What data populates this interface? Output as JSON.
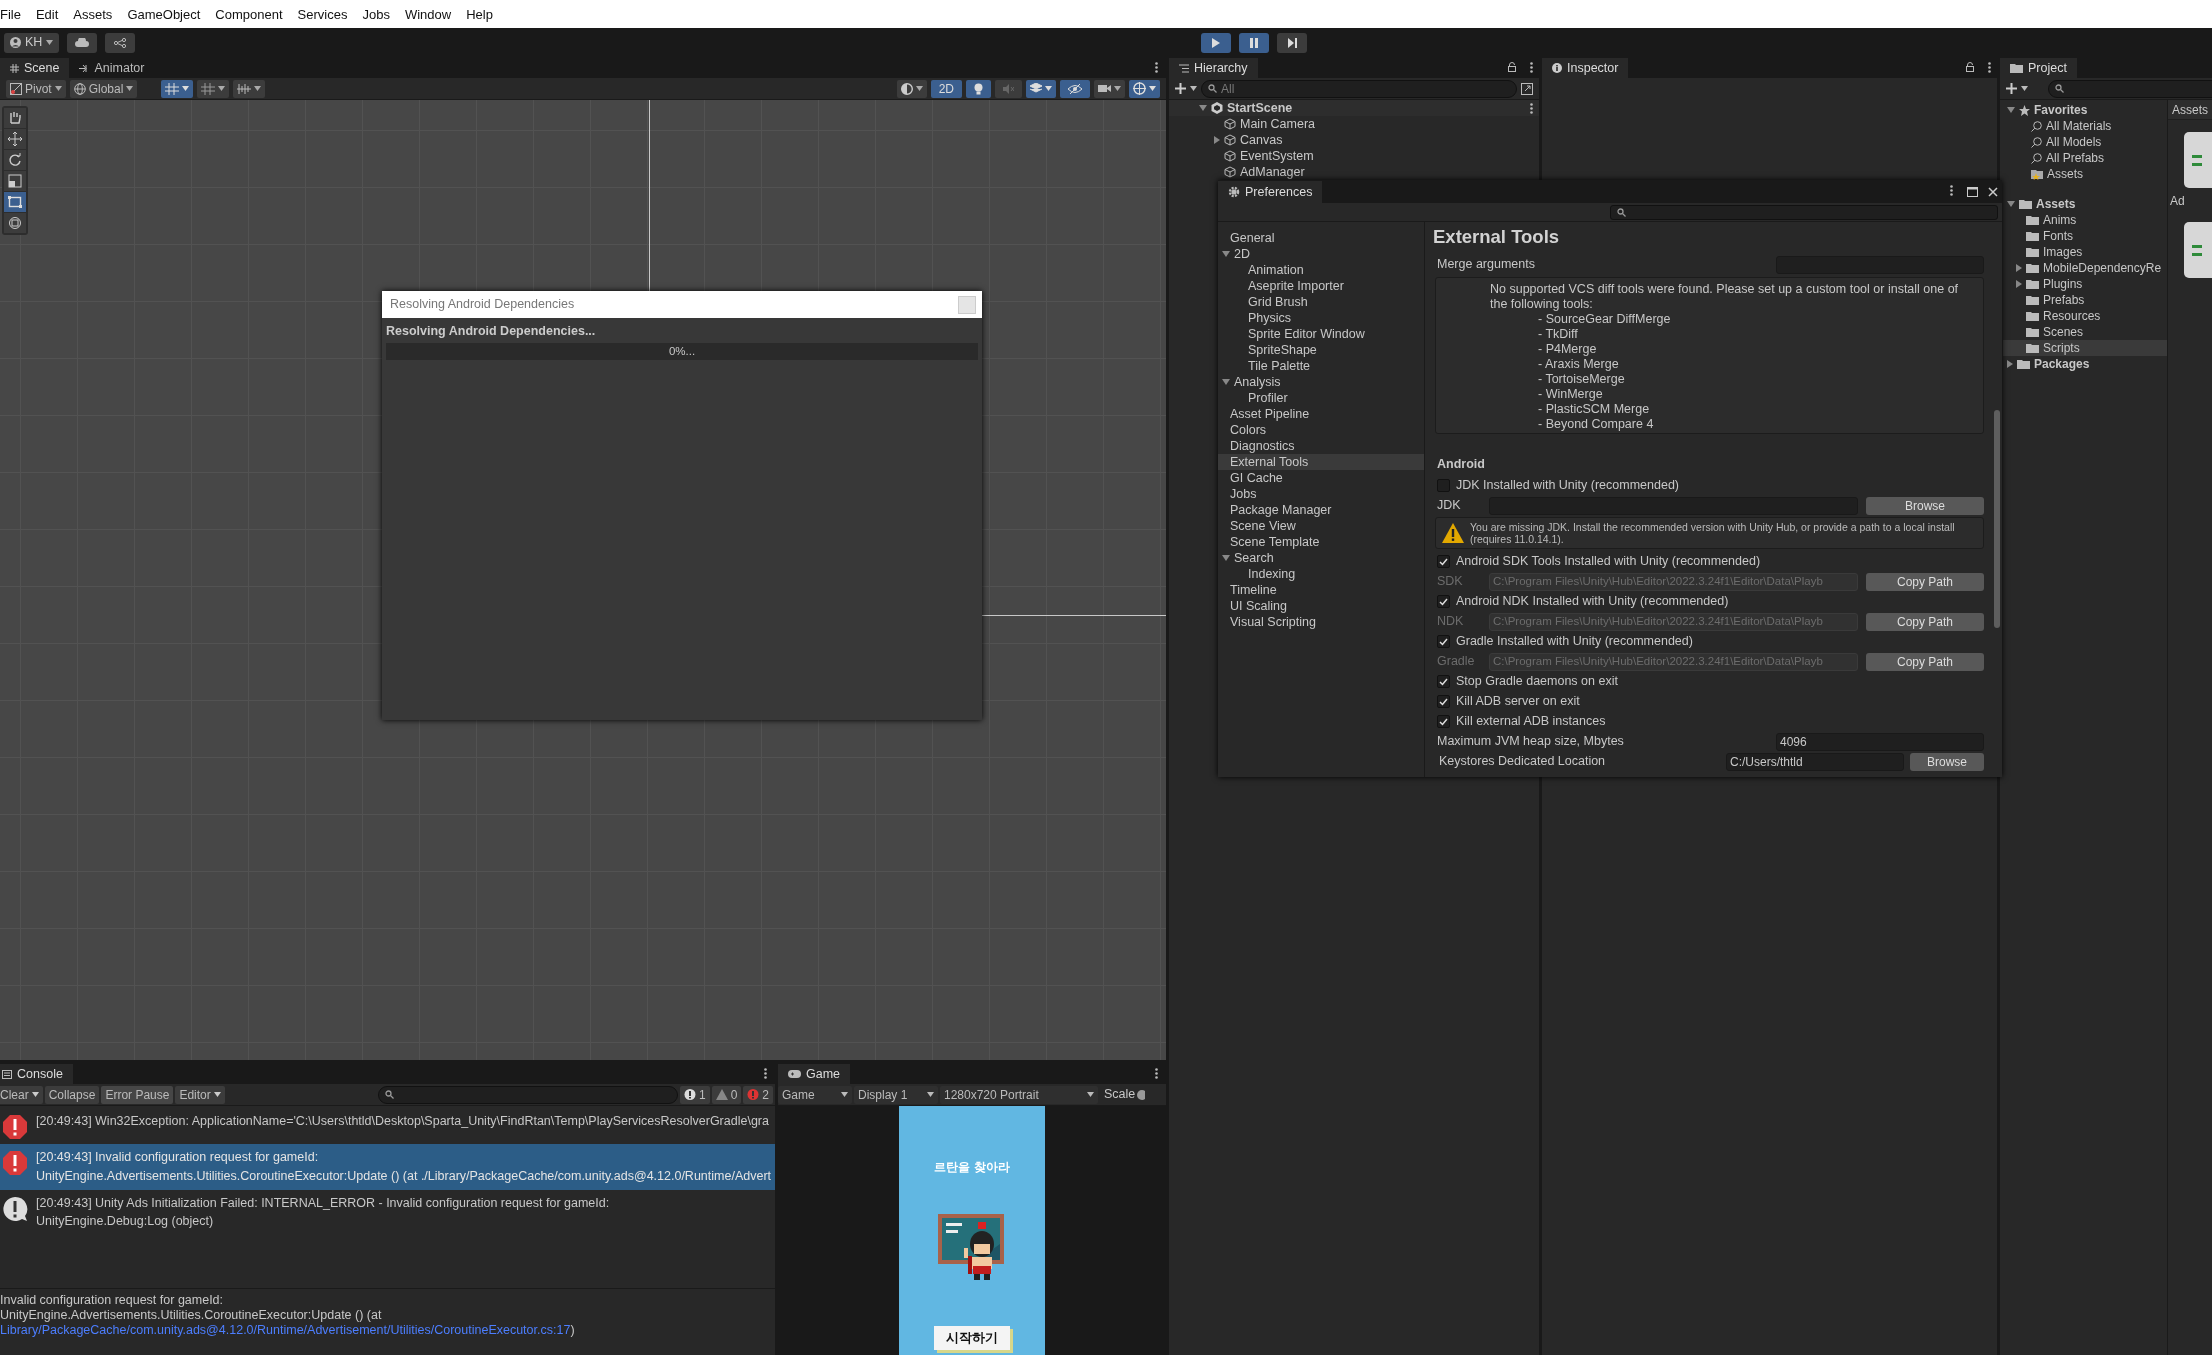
{
  "menu_bar": [
    "File",
    "Edit",
    "Assets",
    "GameObject",
    "Component",
    "Services",
    "Jobs",
    "Window",
    "Help"
  ],
  "toolbar": {
    "account": "KH",
    "playing": true,
    "paused": true
  },
  "scene_panel": {
    "tabs": [
      {
        "label": "Scene",
        "selected": true
      },
      {
        "label": "Animator",
        "selected": false
      }
    ],
    "pivot": "Pivot",
    "space": "Global",
    "mode_2d": {
      "label": "2D",
      "on": true
    },
    "toggles": [
      {
        "kind": "grid_snap",
        "on": true
      },
      {
        "kind": "lighting",
        "on": true
      },
      {
        "kind": "audio",
        "on": false
      },
      {
        "kind": "effects",
        "on": true
      },
      {
        "kind": "visibility",
        "on": true
      },
      {
        "kind": "gizmos",
        "on": true
      }
    ],
    "tools": [
      {
        "kind": "hand",
        "selected": false
      },
      {
        "kind": "move",
        "selected": false
      },
      {
        "kind": "rotate",
        "selected": false
      },
      {
        "kind": "scale",
        "selected": false
      },
      {
        "kind": "rect",
        "selected": true
      },
      {
        "kind": "transform",
        "selected": false
      }
    ]
  },
  "dialog": {
    "title": "Resolving Android Dependencies",
    "message": "Resolving Android Dependencies...",
    "progress_label": "0%...",
    "level": 0
  },
  "hierarchy": {
    "title": "Hierarchy",
    "placeholder": "All",
    "scene": "StartScene",
    "items": [
      {
        "label": "Main Camera",
        "expandable": false
      },
      {
        "label": "Canvas",
        "expandable": true
      },
      {
        "label": "EventSystem",
        "expandable": false
      },
      {
        "label": "AdManager",
        "expandable": false
      }
    ]
  },
  "inspector": {
    "title": "Inspector"
  },
  "preferences": {
    "title": "Preferences",
    "nav": [
      {
        "label": "General",
        "selected": false
      },
      {
        "label": "2D",
        "selected": false,
        "expanded": true,
        "children": [
          {
            "label": "Animation",
            "selected": false
          },
          {
            "label": "Aseprite Importer",
            "selected": false
          },
          {
            "label": "Grid Brush",
            "selected": false
          },
          {
            "label": "Physics",
            "selected": false
          },
          {
            "label": "Sprite Editor Window",
            "selected": false
          },
          {
            "label": "SpriteShape",
            "selected": false
          },
          {
            "label": "Tile Palette",
            "selected": false
          }
        ]
      },
      {
        "label": "Analysis",
        "selected": false,
        "expanded": true,
        "children": [
          {
            "label": "Profiler",
            "selected": false
          }
        ]
      },
      {
        "label": "Asset Pipeline",
        "selected": false
      },
      {
        "label": "Colors",
        "selected": false
      },
      {
        "label": "Diagnostics",
        "selected": false
      },
      {
        "label": "External Tools",
        "selected": true
      },
      {
        "label": "GI Cache",
        "selected": false
      },
      {
        "label": "Jobs",
        "selected": false
      },
      {
        "label": "Package Manager",
        "selected": false
      },
      {
        "label": "Scene View",
        "selected": false
      },
      {
        "label": "Scene Template",
        "selected": false
      },
      {
        "label": "Search",
        "selected": false,
        "expanded": true,
        "children": [
          {
            "label": "Indexing",
            "selected": false
          }
        ]
      },
      {
        "label": "Timeline",
        "selected": false
      },
      {
        "label": "UI Scaling",
        "selected": false
      },
      {
        "label": "Visual Scripting",
        "selected": false
      }
    ],
    "page_title": "External Tools",
    "merge_label": "Merge arguments",
    "vcs_message": "No supported VCS diff tools were found. Please set up a custom tool or install one of the following tools:",
    "vcs_tools": [
      "- SourceGear DiffMerge",
      "- TkDiff",
      "- P4Merge",
      "- Araxis Merge",
      "- TortoiseMerge",
      "- WinMerge",
      "- PlasticSCM Merge",
      "- Beyond Compare 4"
    ],
    "android_heading": "Android",
    "settings": [
      {
        "kind": "checkbox",
        "label": "JDK Installed with Unity (recommended)",
        "checked": false
      },
      {
        "kind": "path",
        "label": "JDK",
        "button": "Browse",
        "disabled": false
      },
      {
        "kind": "warning",
        "text": "You are missing JDK. Install the recommended version with Unity Hub, or provide a path to a local install (requires 11.0.14.1)."
      },
      {
        "kind": "checkbox",
        "label": "Android SDK Tools Installed with Unity (recommended)",
        "checked": true
      },
      {
        "kind": "path",
        "label": "SDK",
        "value": "C:\\Program Files\\Unity\\Hub\\Editor\\2022.3.24f1\\Editor\\Data\\Playb",
        "button": "Copy Path",
        "disabled": true
      },
      {
        "kind": "checkbox",
        "label": "Android NDK Installed with Unity (recommended)",
        "checked": true
      },
      {
        "kind": "path",
        "label": "NDK",
        "value": "C:\\Program Files\\Unity\\Hub\\Editor\\2022.3.24f1\\Editor\\Data\\Playb",
        "button": "Copy Path",
        "disabled": true
      },
      {
        "kind": "checkbox",
        "label": "Gradle Installed with Unity (recommended)",
        "checked": true
      },
      {
        "kind": "path",
        "label": "Gradle",
        "value": "C:\\Program Files\\Unity\\Hub\\Editor\\2022.3.24f1\\Editor\\Data\\Playb",
        "button": "Copy Path",
        "disabled": true
      },
      {
        "kind": "checkbox",
        "label": "Stop Gradle daemons on exit",
        "checked": true
      },
      {
        "kind": "checkbox",
        "label": "Kill ADB server on exit",
        "checked": true
      },
      {
        "kind": "checkbox",
        "label": "Kill external ADB instances",
        "checked": true
      },
      {
        "kind": "number",
        "label": "Maximum JVM heap size, Mbytes",
        "value": "4096"
      },
      {
        "kind": "location",
        "label": "Keystores Dedicated Location",
        "value": "C:/Users/thtld",
        "button": "Browse"
      }
    ]
  },
  "project": {
    "title": "Project",
    "tree": [
      {
        "label": "Favorites",
        "kind": "favorites",
        "expanded": true,
        "children": [
          {
            "label": "All Materials",
            "kind": "search"
          },
          {
            "label": "All Models",
            "kind": "search"
          },
          {
            "label": "All Prefabs",
            "kind": "search"
          },
          {
            "label": "Assets",
            "kind": "favorite-folder"
          }
        ]
      },
      {
        "label": "Assets",
        "kind": "root",
        "expanded": true,
        "children": [
          {
            "label": "Anims",
            "kind": "folder",
            "expandable": false,
            "selected": false
          },
          {
            "label": "Fonts",
            "kind": "folder",
            "expandable": false,
            "selected": false
          },
          {
            "label": "Images",
            "kind": "folder",
            "expandable": false,
            "selected": false
          },
          {
            "label": "MobileDependencyRe",
            "kind": "folder",
            "expandable": true,
            "selected": false
          },
          {
            "label": "Plugins",
            "kind": "folder",
            "expandable": true,
            "selected": false
          },
          {
            "label": "Prefabs",
            "kind": "folder",
            "expandable": false,
            "selected": false
          },
          {
            "label": "Resources",
            "kind": "folder",
            "expandable": false,
            "selected": false
          },
          {
            "label": "Scenes",
            "kind": "folder",
            "expandable": false,
            "selected": false
          },
          {
            "label": "Scripts",
            "kind": "folder",
            "expandable": false,
            "selected": true
          }
        ]
      },
      {
        "label": "Packages",
        "kind": "root",
        "expanded": false
      }
    ],
    "breadcrumb": "Assets",
    "files": [
      {
        "kind": "script",
        "label": "Ad"
      },
      {
        "kind": "script"
      }
    ]
  },
  "console": {
    "title": "Console",
    "buttons": [
      "Clear",
      "Collapse",
      "Error Pause",
      "Editor"
    ],
    "counts": {
      "log": "1",
      "warning": "0",
      "error": "2"
    },
    "messages": [
      {
        "kind": "error",
        "selected": false,
        "lines": [
          "[20:49:43] Win32Exception: ApplicationName='C:\\Users\\thtld\\Desktop\\Sparta_Unity\\FindRtan\\Temp\\PlayServicesResolverGradle\\gra"
        ]
      },
      {
        "kind": "error",
        "selected": true,
        "lines": [
          "[20:49:43] Invalid configuration request for gameId:",
          "UnityEngine.Advertisements.Utilities.CoroutineExecutor:Update () (at ./Library/PackageCache/com.unity.ads@4.12.0/Runtime/Advert"
        ]
      },
      {
        "kind": "log",
        "selected": false,
        "lines": [
          "[20:49:43] Unity Ads Initialization Failed: INTERNAL_ERROR - Invalid configuration request for gameId:",
          "UnityEngine.Debug:Log (object)"
        ]
      }
    ],
    "detail": [
      "Invalid configuration request for gameId:",
      "UnityEngine.Advertisements.Utilities.CoroutineExecutor:Update () (at"
    ],
    "detail_link": "Library/PackageCache/com.unity.ads@4.12.0/Runtime/Advertisement/Utilities/CoroutineExecutor.cs:17",
    "detail_tail": ")"
  },
  "game": {
    "title": "Game",
    "view": "Game",
    "display": "Display 1",
    "resolution": "1280x720 Portrait",
    "scale": "Scale",
    "screen_title": "르탄을 찾아라",
    "start_button": "시작하기"
  }
}
